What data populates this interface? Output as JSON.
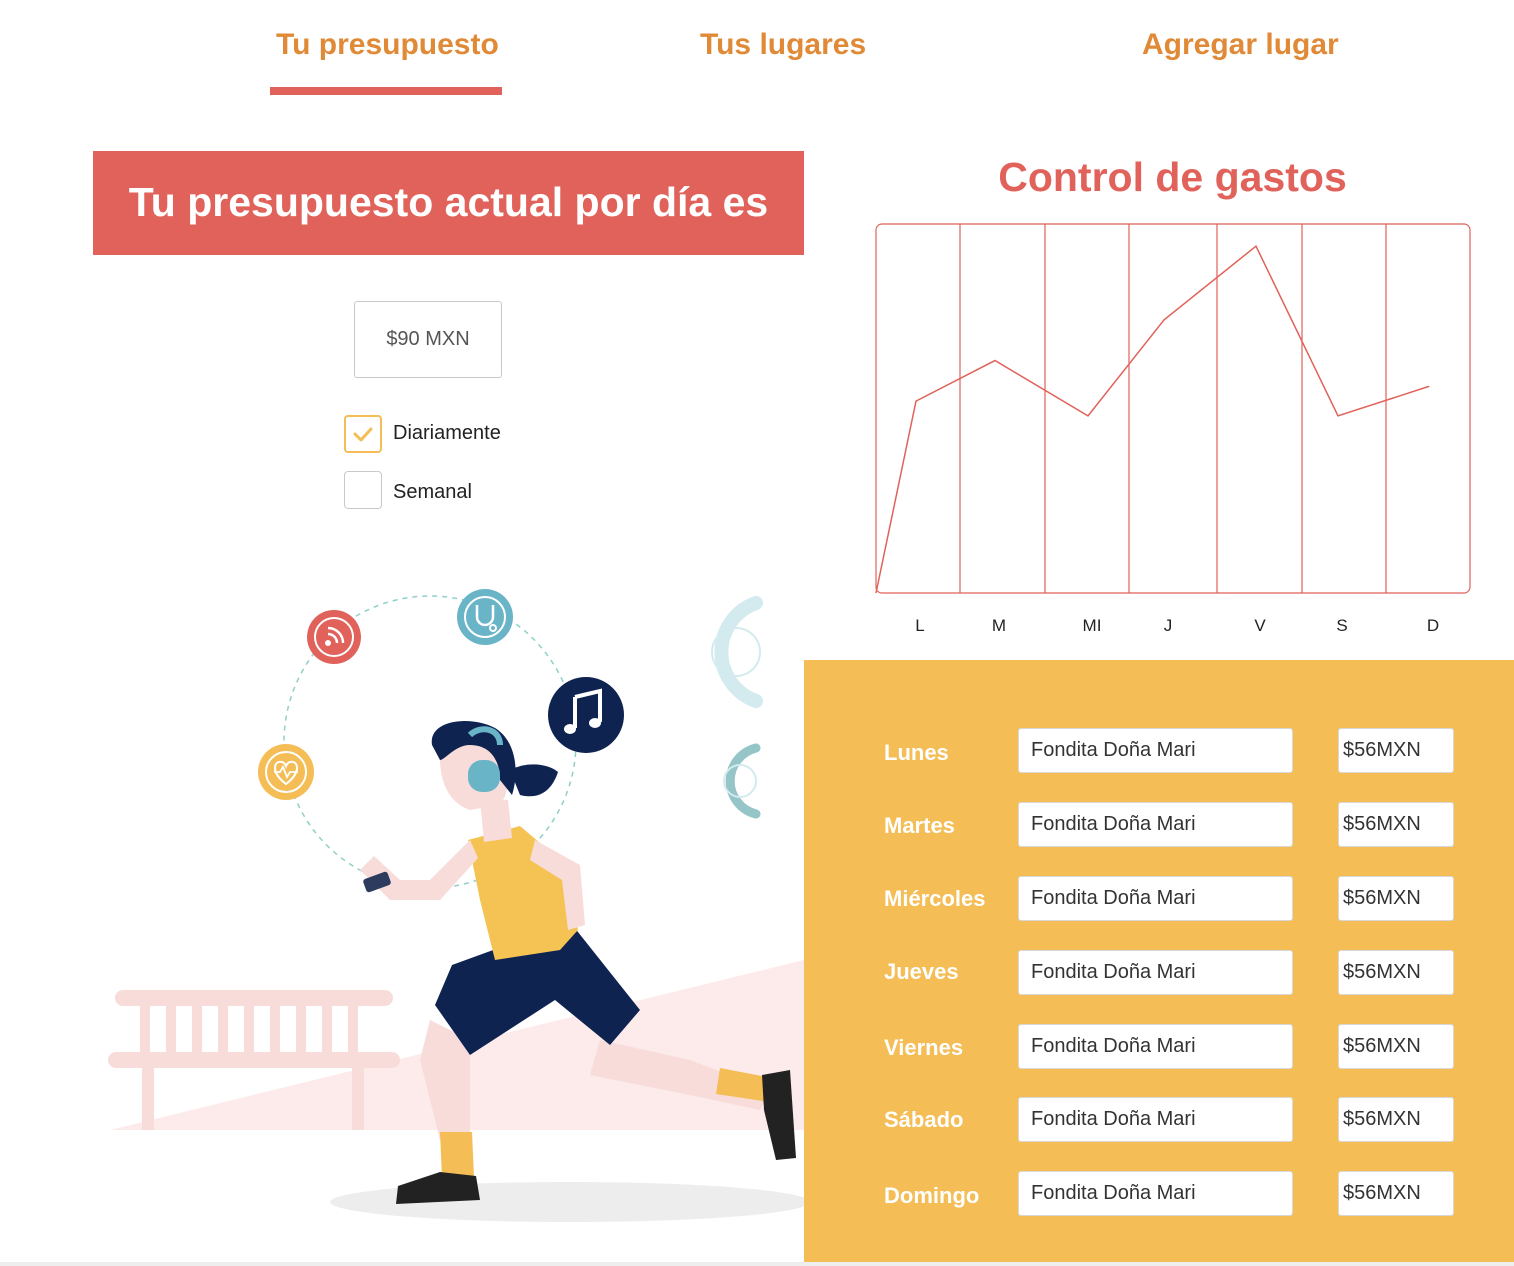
{
  "nav": {
    "tabs": [
      {
        "label": "Tu presupuesto",
        "active": true
      },
      {
        "label": "Tus lugares",
        "active": false
      },
      {
        "label": "Agregar lugar",
        "active": false
      }
    ]
  },
  "budget": {
    "banner_text": "Tu presupuesto actual por día es",
    "amount": "$90 MXN",
    "frequency_options": [
      {
        "label": "Diariamente",
        "checked": true
      },
      {
        "label": "Semanal",
        "checked": false
      }
    ]
  },
  "chart_data": {
    "type": "line",
    "title": "Control de gastos",
    "categories": [
      "L",
      "M",
      "MI",
      "J",
      "V",
      "S",
      "D"
    ],
    "series": [
      {
        "values": [
          52,
          63,
          48,
          74,
          94,
          48,
          56
        ]
      }
    ],
    "ylim": [
      0,
      100
    ],
    "grid": true,
    "color": "#e0625a"
  },
  "expenses": {
    "rows": [
      {
        "day": "Lunes",
        "place": "Fondita Doña Mari",
        "price": "$56MXN"
      },
      {
        "day": "Martes",
        "place": "Fondita Doña Mari",
        "price": "$56MXN"
      },
      {
        "day": "Miércoles",
        "place": "Fondita Doña Mari",
        "price": "$56MXN"
      },
      {
        "day": "Jueves",
        "place": "Fondita Doña Mari",
        "price": "$56MXN"
      },
      {
        "day": "Viernes",
        "place": "Fondita Doña Mari",
        "price": "$56MXN"
      },
      {
        "day": "Sábado",
        "place": "Fondita Doña Mari",
        "price": "$56MXN"
      },
      {
        "day": "Domingo",
        "place": "Fondita Doña Mari",
        "price": "$56MXN"
      }
    ]
  },
  "illustration": {
    "icons": [
      "rss-icon",
      "stethoscope-icon",
      "music-note-icon",
      "heart-rate-icon"
    ],
    "colors": {
      "accent": "#e0625a",
      "orange": "#e08a37",
      "yellow": "#f4bd55",
      "navy": "#0f2350",
      "teal": "#6ab4c8"
    }
  }
}
